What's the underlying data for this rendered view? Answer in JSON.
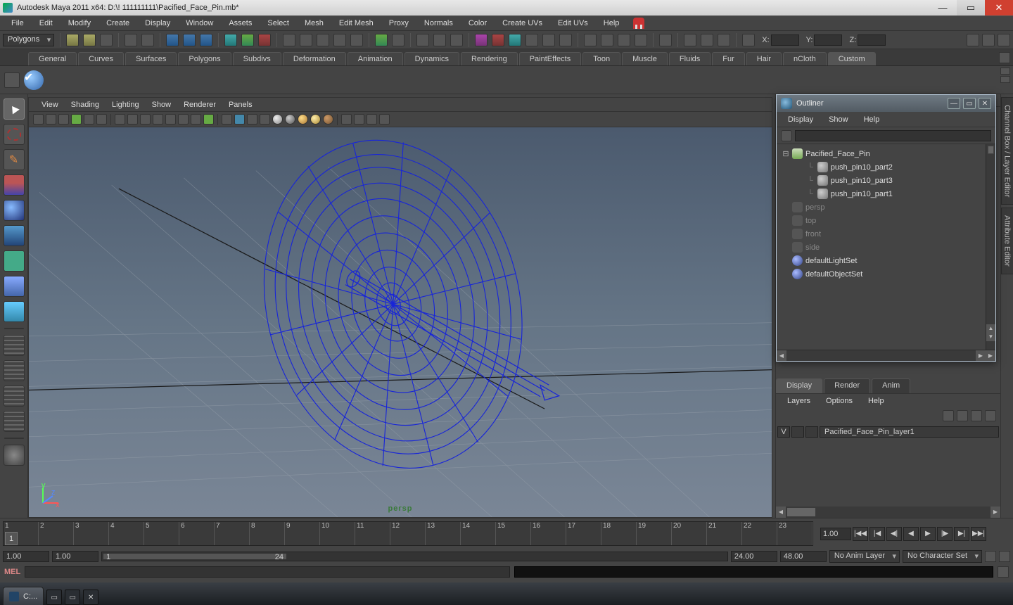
{
  "app": {
    "title": "Autodesk Maya 2011 x64: D:\\! 111111111\\Pacified_Face_Pin.mb*"
  },
  "menubar": [
    "File",
    "Edit",
    "Modify",
    "Create",
    "Display",
    "Window",
    "Assets",
    "Select",
    "Mesh",
    "Edit Mesh",
    "Proxy",
    "Normals",
    "Color",
    "Create UVs",
    "Edit UVs",
    "Help"
  ],
  "mode_selector": "Polygons",
  "coords": {
    "x": "X:",
    "y": "Y:",
    "z": "Z:"
  },
  "shelf_tabs": [
    "General",
    "Curves",
    "Surfaces",
    "Polygons",
    "Subdivs",
    "Deformation",
    "Animation",
    "Dynamics",
    "Rendering",
    "PaintEffects",
    "Toon",
    "Muscle",
    "Fluids",
    "Fur",
    "Hair",
    "nCloth",
    "Custom"
  ],
  "shelf_active": "Custom",
  "viewport_menu": [
    "View",
    "Shading",
    "Lighting",
    "Show",
    "Renderer",
    "Panels"
  ],
  "persp_label": "persp",
  "right_header": "Channel Box / Layer Editor",
  "right_side_tabs": [
    "Channel Box / Layer Editor",
    "Attribute Editor"
  ],
  "outliner": {
    "title": "Outliner",
    "menu": [
      "Display",
      "Show",
      "Help"
    ],
    "items": [
      {
        "icon": "grp",
        "label": "Pacified_Face_Pin",
        "indent": 0,
        "expand": "⊟",
        "dim": false
      },
      {
        "icon": "mesh",
        "label": "push_pin10_part2",
        "indent": 1,
        "expand": "",
        "dim": false,
        "line": true
      },
      {
        "icon": "mesh",
        "label": "push_pin10_part3",
        "indent": 1,
        "expand": "",
        "dim": false,
        "line": true
      },
      {
        "icon": "mesh",
        "label": "push_pin10_part1",
        "indent": 1,
        "expand": "",
        "dim": false,
        "line": true
      },
      {
        "icon": "cam",
        "label": "persp",
        "indent": 0,
        "expand": "",
        "dim": true
      },
      {
        "icon": "cam",
        "label": "top",
        "indent": 0,
        "expand": "",
        "dim": true
      },
      {
        "icon": "cam",
        "label": "front",
        "indent": 0,
        "expand": "",
        "dim": true
      },
      {
        "icon": "cam",
        "label": "side",
        "indent": 0,
        "expand": "",
        "dim": true
      },
      {
        "icon": "set",
        "label": "defaultLightSet",
        "indent": 0,
        "expand": "",
        "dim": false
      },
      {
        "icon": "set",
        "label": "defaultObjectSet",
        "indent": 0,
        "expand": "",
        "dim": false
      }
    ]
  },
  "layer_tabs": [
    "Display",
    "Render",
    "Anim"
  ],
  "layer_tab_active": "Display",
  "layer_menu": [
    "Layers",
    "Options",
    "Help"
  ],
  "layers": [
    {
      "vis": "V",
      "type": "",
      "name": "Pacified_Face_Pin_layer1"
    }
  ],
  "timeline": {
    "ticks": [
      "1",
      "2",
      "3",
      "4",
      "5",
      "6",
      "7",
      "8",
      "9",
      "10",
      "11",
      "12",
      "13",
      "14",
      "15",
      "16",
      "17",
      "18",
      "19",
      "20",
      "21",
      "22",
      "23"
    ],
    "current": "1",
    "cur_field": "1.00"
  },
  "range": {
    "start": "1.00",
    "in": "1.00",
    "slider_from": "1",
    "slider_to": "24",
    "out": "24.00",
    "end": "48.00",
    "anim_layer": "No Anim Layer",
    "char_set": "No Character Set"
  },
  "cmd": {
    "lang": "MEL"
  },
  "taskbar": {
    "item": "C:..."
  }
}
